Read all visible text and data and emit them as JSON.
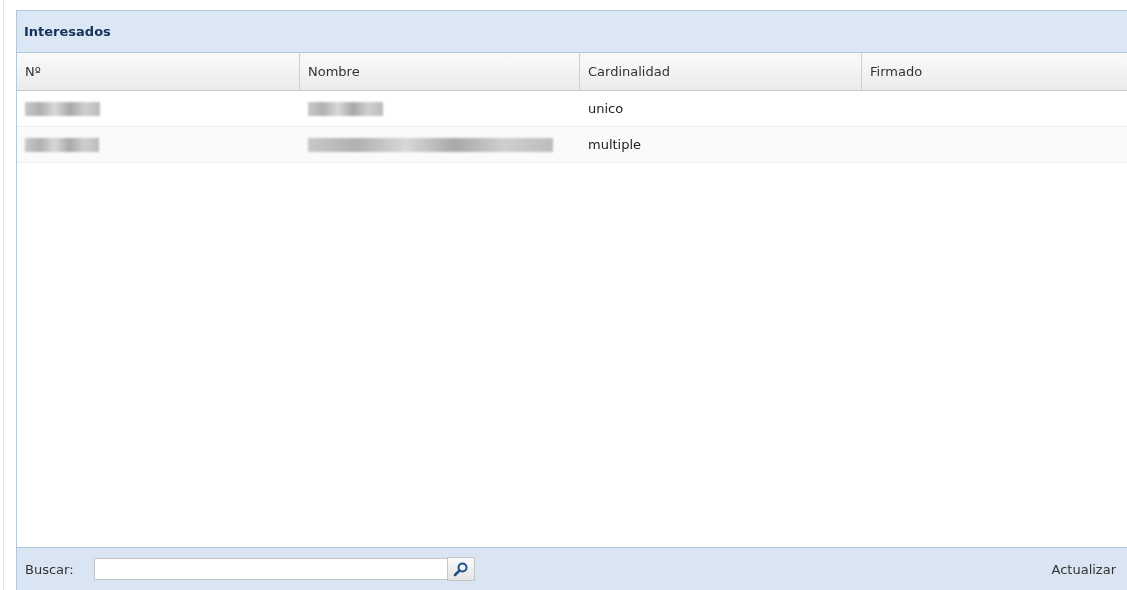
{
  "panel": {
    "title": "Interesados"
  },
  "table": {
    "columns": [
      "Nº",
      "Nombre",
      "Cardinalidad",
      "Firmado"
    ],
    "rows": [
      {
        "cells": [
          {
            "kind": "redacted"
          },
          {
            "kind": "redacted"
          },
          {
            "kind": "text",
            "text": "unico"
          },
          {
            "kind": "empty"
          }
        ]
      },
      {
        "cells": [
          {
            "kind": "redacted"
          },
          {
            "kind": "redacted"
          },
          {
            "kind": "text",
            "text": "multiple"
          },
          {
            "kind": "empty"
          }
        ]
      }
    ]
  },
  "footer": {
    "search_label": "Buscar:",
    "refresh": "Actualizar"
  }
}
